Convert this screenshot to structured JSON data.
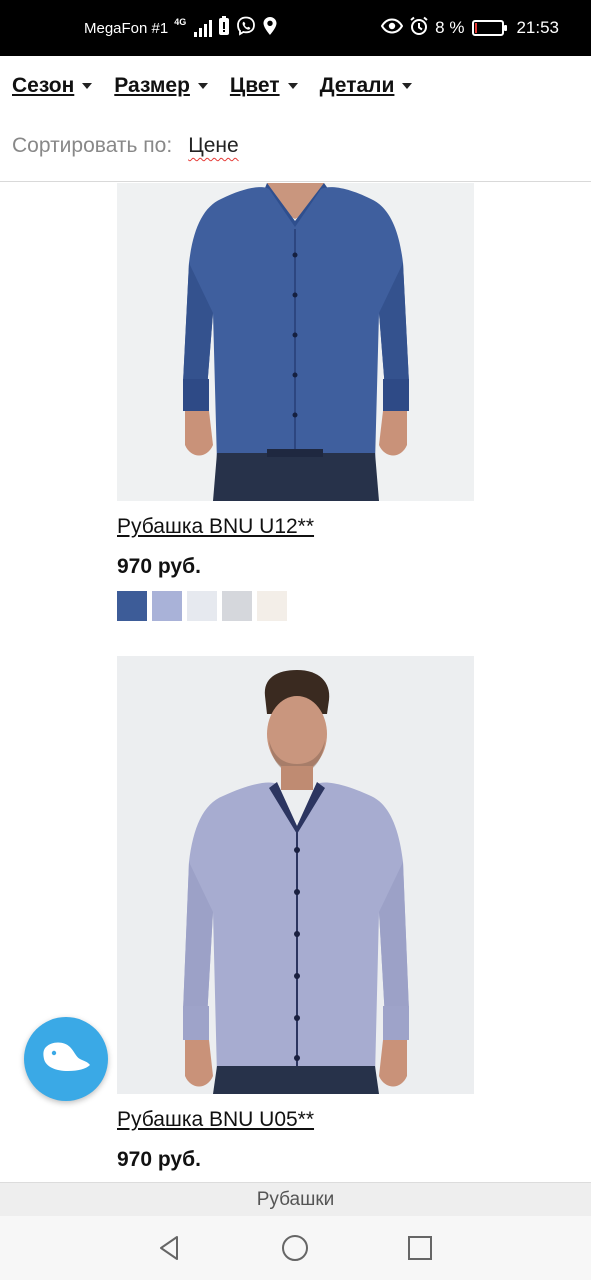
{
  "status_bar": {
    "carrier": "MegaFon #1",
    "network": "4G",
    "battery_text": "8 %",
    "battery_level": 0.08,
    "time": "21:53",
    "icons": [
      "signal-icon",
      "battery-alert-icon",
      "viber-icon",
      "location-icon",
      "eye-icon",
      "alarm-icon",
      "battery-icon"
    ]
  },
  "filters": {
    "items": [
      {
        "label": "Сезон"
      },
      {
        "label": "Размер"
      },
      {
        "label": "Цвет"
      },
      {
        "label": "Детали"
      }
    ],
    "sort_label": "Сортировать по:",
    "sort_value": "Цене"
  },
  "products": [
    {
      "name": "Рубашка BNU U12**",
      "price": "970 руб.",
      "shirt_color": "#3f5f9e",
      "swatches": [
        "#3d5c98",
        "#a9b2d8",
        "#e6e9ef",
        "#d5d7dc",
        "#f3eee8"
      ]
    },
    {
      "name": "Рубашка BNU U05**",
      "price": "970 руб.",
      "shirt_color": "#a7acd0",
      "swatches": [
        "#c8c9d9",
        "#3c4e86",
        "#a33040",
        "#8fa6cf",
        "#6f78ad"
      ]
    }
  ],
  "chat": {
    "icon": "chat-bubble-icon",
    "color": "#3aa9e6"
  },
  "category_bar": {
    "label": "Рубашки"
  },
  "nav_bar": {
    "icons": [
      "back-icon",
      "home-icon",
      "recents-icon"
    ]
  }
}
